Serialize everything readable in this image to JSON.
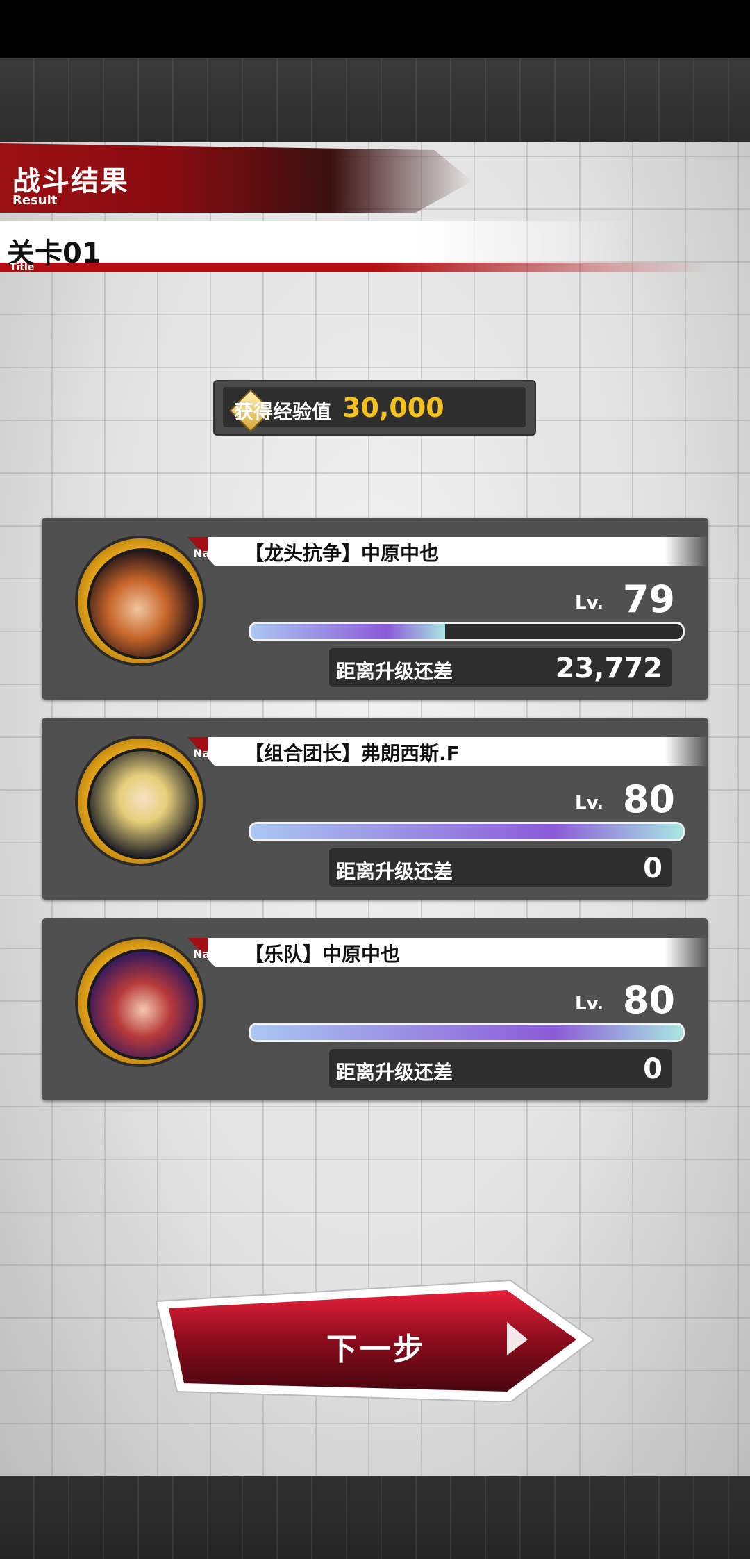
{
  "header": {
    "title": "战斗结果",
    "subtitle": "Result",
    "stage_title": "关卡01",
    "stage_subtitle": "Title"
  },
  "reward": {
    "label": "获得经验值",
    "value": "30,000"
  },
  "characters": [
    {
      "name_tag": "Name",
      "name": "【龙头抗争】中原中也",
      "lv_label": "Lv.",
      "level": "79",
      "exp_progress": 0.45,
      "next_label": "距离升级还差",
      "next_value": "23,772"
    },
    {
      "name_tag": "Name",
      "name": "【组合团长】弗朗西斯.F",
      "lv_label": "Lv.",
      "level": "80",
      "exp_progress": 1.0,
      "next_label": "距离升级还差",
      "next_value": "0"
    },
    {
      "name_tag": "Name",
      "name": "【乐队】中原中也",
      "lv_label": "Lv.",
      "level": "80",
      "exp_progress": 1.0,
      "next_label": "距离升级还差",
      "next_value": "0"
    }
  ],
  "next_button": {
    "label": "下一步"
  },
  "colors": {
    "accent_red": "#a10f14",
    "exp_gold": "#f5c21b",
    "panel": "#505050"
  }
}
